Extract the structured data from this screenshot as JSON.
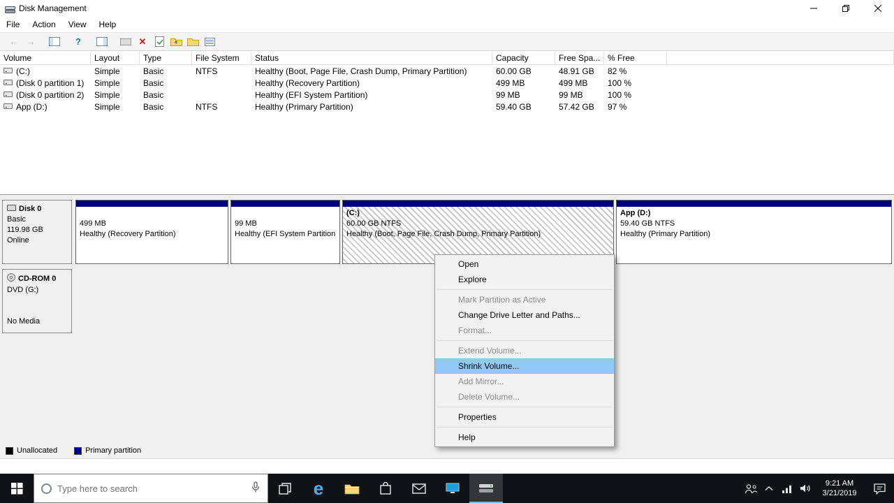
{
  "window": {
    "title": "Disk Management",
    "controls": {
      "minimize": "minimize",
      "restore": "restore",
      "close": "close"
    }
  },
  "menubar": {
    "items": [
      "File",
      "Action",
      "View",
      "Help"
    ]
  },
  "toolbar": {
    "icons": [
      "back",
      "forward",
      "show-console-tree",
      "help",
      "show-action-pane",
      "screen",
      "delete-volume",
      "check-document",
      "up-folder",
      "folder",
      "list-view"
    ],
    "glyphs": {
      "back": "←",
      "forward": "→",
      "help": "?",
      "delete": "✕"
    }
  },
  "volume_table": {
    "columns": [
      "Volume",
      "Layout",
      "Type",
      "File System",
      "Status",
      "Capacity",
      "Free Spa...",
      "% Free"
    ],
    "rows": [
      {
        "volume": "(C:)",
        "layout": "Simple",
        "type": "Basic",
        "fs": "NTFS",
        "status": "Healthy (Boot, Page File, Crash Dump, Primary Partition)",
        "capacity": "60.00 GB",
        "free": "48.91 GB",
        "pct": "82 %"
      },
      {
        "volume": "(Disk 0 partition 1)",
        "layout": "Simple",
        "type": "Basic",
        "fs": "",
        "status": "Healthy (Recovery Partition)",
        "capacity": "499 MB",
        "free": "499 MB",
        "pct": "100 %"
      },
      {
        "volume": "(Disk 0 partition 2)",
        "layout": "Simple",
        "type": "Basic",
        "fs": "",
        "status": "Healthy (EFI System Partition)",
        "capacity": "99 MB",
        "free": "99 MB",
        "pct": "100 %"
      },
      {
        "volume": "App (D:)",
        "layout": "Simple",
        "type": "Basic",
        "fs": "NTFS",
        "status": "Healthy (Primary Partition)",
        "capacity": "59.40 GB",
        "free": "57.42 GB",
        "pct": "97 %"
      }
    ]
  },
  "graph": {
    "disk0": {
      "name": "Disk 0",
      "kind": "Basic",
      "size": "119.98 GB",
      "state": "Online",
      "partitions": [
        {
          "name": "",
          "size_line": "499 MB",
          "status_line": "Healthy (Recovery Partition)"
        },
        {
          "name": "",
          "size_line": "99 MB",
          "status_line": "Healthy (EFI System Partition)"
        },
        {
          "name": "(C:)",
          "size_line": "60.00 GB NTFS",
          "status_line": "Healthy (Boot, Page File, Crash Dump, Primary Partition)"
        },
        {
          "name": "App  (D:)",
          "size_line": "59.40 GB NTFS",
          "status_line": "Healthy (Primary Partition)"
        }
      ]
    },
    "cdrom": {
      "name": "CD-ROM 0",
      "kind": "DVD (G:)",
      "state": "No Media"
    }
  },
  "context_menu": {
    "items": [
      {
        "label": "Open",
        "state": "normal"
      },
      {
        "label": "Explore",
        "state": "normal"
      },
      {
        "label": "Mark Partition as Active",
        "state": "disabled"
      },
      {
        "label": "Change Drive Letter and Paths...",
        "state": "normal"
      },
      {
        "label": "Format...",
        "state": "disabled"
      },
      {
        "label": "Extend Volume...",
        "state": "disabled"
      },
      {
        "label": "Shrink Volume...",
        "state": "highlighted"
      },
      {
        "label": "Add Mirror...",
        "state": "disabled"
      },
      {
        "label": "Delete Volume...",
        "state": "disabled"
      },
      {
        "label": "Properties",
        "state": "normal"
      },
      {
        "label": "Help",
        "state": "normal"
      }
    ]
  },
  "legend": [
    {
      "label": "Unallocated",
      "color": "#000000"
    },
    {
      "label": "Primary partition",
      "color": "#000080"
    }
  ],
  "taskbar": {
    "search_placeholder": "Type here to search",
    "time": "9:21 AM",
    "date": "3/21/2019",
    "pinned": [
      "task-view",
      "edge",
      "file-explorer",
      "store",
      "mail",
      "computer",
      "disk-management"
    ],
    "tray": [
      "people",
      "hidden-icons",
      "network",
      "volume",
      "clock",
      "action-center"
    ],
    "edge_glyph": "e"
  },
  "colors": {
    "primary_partition": "#000080",
    "unallocated": "#000000",
    "menu_highlight": "#90c8f6",
    "taskbar_bg": "#101316",
    "active_app_underline": "#76b9ed"
  }
}
